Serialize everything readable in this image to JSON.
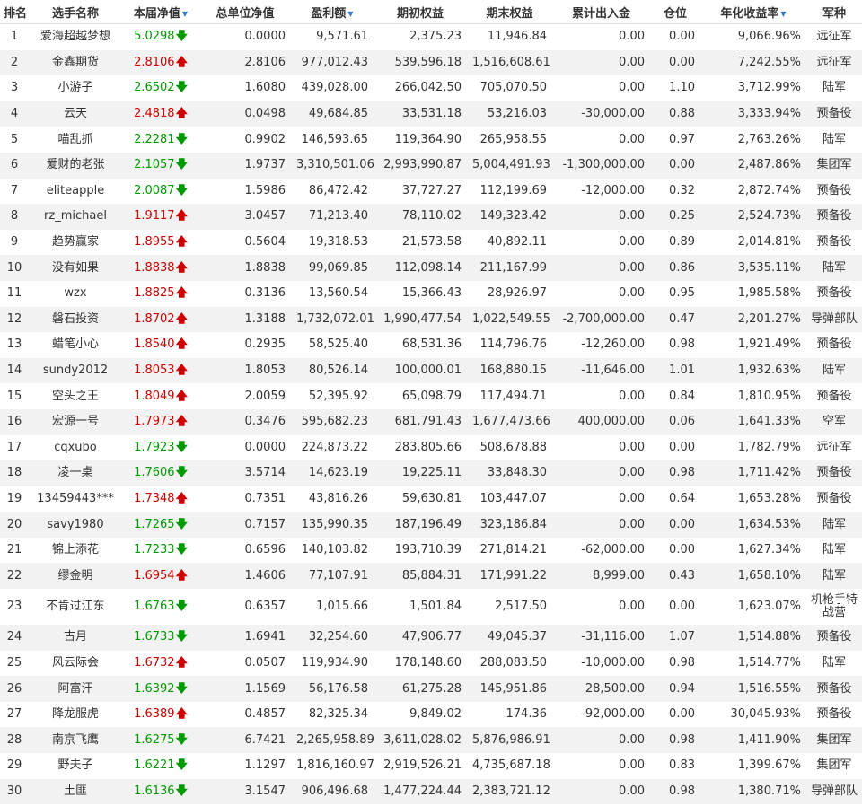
{
  "columns": [
    {
      "label": "排名",
      "sortable": false
    },
    {
      "label": "选手名称",
      "sortable": false
    },
    {
      "label": "本届净值",
      "sortable": true
    },
    {
      "label": "总单位净值",
      "sortable": false
    },
    {
      "label": "盈利额",
      "sortable": true
    },
    {
      "label": "期初权益",
      "sortable": false
    },
    {
      "label": "期末权益",
      "sortable": false
    },
    {
      "label": "累计出入金",
      "sortable": false
    },
    {
      "label": "仓位",
      "sortable": false
    },
    {
      "label": "年化收益率",
      "sortable": true
    },
    {
      "label": "军种",
      "sortable": false
    }
  ],
  "colors": {
    "up": "#cc0000",
    "down": "#009900",
    "sort_icon": "#2e7bd6",
    "row_alt": "#f2f2f2"
  },
  "icons": {
    "sort": "sort-down-triangle",
    "up": "arrow-up",
    "down": "arrow-down"
  },
  "rows": [
    {
      "rank": "1",
      "name": "爱海超越梦想",
      "nav": "5.0298",
      "dir": "down",
      "unit_nav": "0.0000",
      "profit": "9,571.61",
      "start": "2,375.23",
      "end": "11,946.84",
      "flow": "0.00",
      "pos": "0.00",
      "annual": "9,066.96%",
      "arm": "远征军"
    },
    {
      "rank": "2",
      "name": "金鑫期货",
      "nav": "2.8106",
      "dir": "up",
      "unit_nav": "2.8106",
      "profit": "977,012.43",
      "start": "539,596.18",
      "end": "1,516,608.61",
      "flow": "0.00",
      "pos": "0.00",
      "annual": "7,242.55%",
      "arm": "远征军"
    },
    {
      "rank": "3",
      "name": "小游子",
      "nav": "2.6502",
      "dir": "down",
      "unit_nav": "1.6080",
      "profit": "439,028.00",
      "start": "266,042.50",
      "end": "705,070.50",
      "flow": "0.00",
      "pos": "1.10",
      "annual": "3,712.99%",
      "arm": "陆军"
    },
    {
      "rank": "4",
      "name": "云天",
      "nav": "2.4818",
      "dir": "up",
      "unit_nav": "0.0498",
      "profit": "49,684.85",
      "start": "33,531.18",
      "end": "53,216.03",
      "flow": "-30,000.00",
      "pos": "0.88",
      "annual": "3,333.94%",
      "arm": "预备役"
    },
    {
      "rank": "5",
      "name": "喵乱抓",
      "nav": "2.2281",
      "dir": "down",
      "unit_nav": "0.9902",
      "profit": "146,593.65",
      "start": "119,364.90",
      "end": "265,958.55",
      "flow": "0.00",
      "pos": "0.97",
      "annual": "2,763.26%",
      "arm": "陆军"
    },
    {
      "rank": "6",
      "name": "爱财的老张",
      "nav": "2.1057",
      "dir": "down",
      "unit_nav": "1.9737",
      "profit": "3,310,501.06",
      "start": "2,993,990.87",
      "end": "5,004,491.93",
      "flow": "-1,300,000.00",
      "pos": "0.00",
      "annual": "2,487.86%",
      "arm": "集团军"
    },
    {
      "rank": "7",
      "name": "eliteapple",
      "nav": "2.0087",
      "dir": "down",
      "unit_nav": "1.5986",
      "profit": "86,472.42",
      "start": "37,727.27",
      "end": "112,199.69",
      "flow": "-12,000.00",
      "pos": "0.32",
      "annual": "2,872.74%",
      "arm": "预备役"
    },
    {
      "rank": "8",
      "name": "rz_michael",
      "nav": "1.9117",
      "dir": "up",
      "unit_nav": "3.0457",
      "profit": "71,213.40",
      "start": "78,110.02",
      "end": "149,323.42",
      "flow": "0.00",
      "pos": "0.25",
      "annual": "2,524.73%",
      "arm": "预备役"
    },
    {
      "rank": "9",
      "name": "趋势赢家",
      "nav": "1.8955",
      "dir": "up",
      "unit_nav": "0.5604",
      "profit": "19,318.53",
      "start": "21,573.58",
      "end": "40,892.11",
      "flow": "0.00",
      "pos": "0.89",
      "annual": "2,014.81%",
      "arm": "预备役"
    },
    {
      "rank": "10",
      "name": "没有如果",
      "nav": "1.8838",
      "dir": "up",
      "unit_nav": "1.8838",
      "profit": "99,069.85",
      "start": "112,098.14",
      "end": "211,167.99",
      "flow": "0.00",
      "pos": "0.86",
      "annual": "3,535.11%",
      "arm": "陆军"
    },
    {
      "rank": "11",
      "name": "wzx",
      "nav": "1.8825",
      "dir": "up",
      "unit_nav": "0.3136",
      "profit": "13,560.54",
      "start": "15,366.43",
      "end": "28,926.97",
      "flow": "0.00",
      "pos": "0.95",
      "annual": "1,985.58%",
      "arm": "预备役"
    },
    {
      "rank": "12",
      "name": "磐石投资",
      "nav": "1.8702",
      "dir": "up",
      "unit_nav": "1.3188",
      "profit": "1,732,072.01",
      "start": "1,990,477.54",
      "end": "1,022,549.55",
      "flow": "-2,700,000.00",
      "pos": "0.47",
      "annual": "2,201.27%",
      "arm": "导弹部队"
    },
    {
      "rank": "13",
      "name": "蜡笔小心",
      "nav": "1.8540",
      "dir": "up",
      "unit_nav": "0.2935",
      "profit": "58,525.40",
      "start": "68,531.36",
      "end": "114,796.76",
      "flow": "-12,260.00",
      "pos": "0.98",
      "annual": "1,921.49%",
      "arm": "预备役"
    },
    {
      "rank": "14",
      "name": "sundy2012",
      "nav": "1.8053",
      "dir": "up",
      "unit_nav": "1.8053",
      "profit": "80,526.14",
      "start": "100,000.01",
      "end": "168,880.15",
      "flow": "-11,646.00",
      "pos": "1.01",
      "annual": "1,932.63%",
      "arm": "陆军"
    },
    {
      "rank": "15",
      "name": "空头之王",
      "nav": "1.8049",
      "dir": "up",
      "unit_nav": "2.0059",
      "profit": "52,395.92",
      "start": "65,098.79",
      "end": "117,494.71",
      "flow": "0.00",
      "pos": "0.84",
      "annual": "1,810.95%",
      "arm": "预备役"
    },
    {
      "rank": "16",
      "name": "宏源一号",
      "nav": "1.7973",
      "dir": "up",
      "unit_nav": "0.3476",
      "profit": "595,682.23",
      "start": "681,791.43",
      "end": "1,677,473.66",
      "flow": "400,000.00",
      "pos": "0.06",
      "annual": "1,641.33%",
      "arm": "空军"
    },
    {
      "rank": "17",
      "name": "cqxubo",
      "nav": "1.7923",
      "dir": "down",
      "unit_nav": "0.0000",
      "profit": "224,873.22",
      "start": "283,805.66",
      "end": "508,678.88",
      "flow": "0.00",
      "pos": "0.00",
      "annual": "1,782.79%",
      "arm": "远征军"
    },
    {
      "rank": "18",
      "name": "凌一桌",
      "nav": "1.7606",
      "dir": "down",
      "unit_nav": "3.5714",
      "profit": "14,623.19",
      "start": "19,225.11",
      "end": "33,848.30",
      "flow": "0.00",
      "pos": "0.98",
      "annual": "1,711.42%",
      "arm": "预备役"
    },
    {
      "rank": "19",
      "name": "13459443***",
      "nav": "1.7348",
      "dir": "up",
      "unit_nav": "0.7351",
      "profit": "43,816.26",
      "start": "59,630.81",
      "end": "103,447.07",
      "flow": "0.00",
      "pos": "0.64",
      "annual": "1,653.28%",
      "arm": "预备役"
    },
    {
      "rank": "20",
      "name": "savy1980",
      "nav": "1.7265",
      "dir": "down",
      "unit_nav": "0.7157",
      "profit": "135,990.35",
      "start": "187,196.49",
      "end": "323,186.84",
      "flow": "0.00",
      "pos": "0.00",
      "annual": "1,634.53%",
      "arm": "陆军"
    },
    {
      "rank": "21",
      "name": "锦上添花",
      "nav": "1.7233",
      "dir": "down",
      "unit_nav": "0.6596",
      "profit": "140,103.82",
      "start": "193,710.39",
      "end": "271,814.21",
      "flow": "-62,000.00",
      "pos": "0.00",
      "annual": "1,627.34%",
      "arm": "陆军"
    },
    {
      "rank": "22",
      "name": "缪金明",
      "nav": "1.6954",
      "dir": "up",
      "unit_nav": "1.4606",
      "profit": "77,107.91",
      "start": "85,884.31",
      "end": "171,991.22",
      "flow": "8,999.00",
      "pos": "0.43",
      "annual": "1,658.10%",
      "arm": "陆军"
    },
    {
      "rank": "23",
      "name": "不肯过江东",
      "nav": "1.6763",
      "dir": "down",
      "unit_nav": "0.6357",
      "profit": "1,015.66",
      "start": "1,501.84",
      "end": "2,517.50",
      "flow": "0.00",
      "pos": "0.00",
      "annual": "1,623.07%",
      "arm": "机枪手特战营"
    },
    {
      "rank": "24",
      "name": "古月",
      "nav": "1.6733",
      "dir": "down",
      "unit_nav": "1.6941",
      "profit": "32,254.60",
      "start": "47,906.77",
      "end": "49,045.37",
      "flow": "-31,116.00",
      "pos": "1.07",
      "annual": "1,514.88%",
      "arm": "预备役"
    },
    {
      "rank": "25",
      "name": "风云际会",
      "nav": "1.6732",
      "dir": "up",
      "unit_nav": "0.0507",
      "profit": "119,934.90",
      "start": "178,148.60",
      "end": "288,083.50",
      "flow": "-10,000.00",
      "pos": "0.98",
      "annual": "1,514.77%",
      "arm": "陆军"
    },
    {
      "rank": "26",
      "name": "阿富汗",
      "nav": "1.6392",
      "dir": "down",
      "unit_nav": "1.1569",
      "profit": "56,176.58",
      "start": "61,275.28",
      "end": "145,951.86",
      "flow": "28,500.00",
      "pos": "0.94",
      "annual": "1,516.55%",
      "arm": "预备役"
    },
    {
      "rank": "27",
      "name": "降龙服虎",
      "nav": "1.6389",
      "dir": "up",
      "unit_nav": "0.4857",
      "profit": "82,325.34",
      "start": "9,849.02",
      "end": "174.36",
      "flow": "-92,000.00",
      "pos": "0.00",
      "annual": "30,045.93%",
      "arm": "预备役"
    },
    {
      "rank": "28",
      "name": "南京飞鹰",
      "nav": "1.6275",
      "dir": "down",
      "unit_nav": "6.7421",
      "profit": "2,265,958.89",
      "start": "3,611,028.02",
      "end": "5,876,986.91",
      "flow": "0.00",
      "pos": "0.98",
      "annual": "1,411.90%",
      "arm": "集团军"
    },
    {
      "rank": "29",
      "name": "野夫子",
      "nav": "1.6221",
      "dir": "down",
      "unit_nav": "1.1297",
      "profit": "1,816,160.97",
      "start": "2,919,526.21",
      "end": "4,735,687.18",
      "flow": "0.00",
      "pos": "0.83",
      "annual": "1,399.67%",
      "arm": "集团军"
    },
    {
      "rank": "30",
      "name": "土匪",
      "nav": "1.6136",
      "dir": "down",
      "unit_nav": "3.1547",
      "profit": "906,496.68",
      "start": "1,477,224.44",
      "end": "2,383,721.12",
      "flow": "0.00",
      "pos": "0.98",
      "annual": "1,380.71%",
      "arm": "导弹部队"
    }
  ]
}
